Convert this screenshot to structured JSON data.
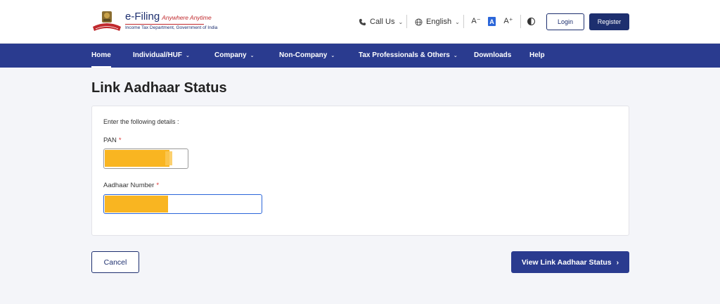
{
  "header": {
    "logo_title": "e-Filing",
    "logo_tagline": "Anywhere Anytime",
    "logo_subtitle": "Income Tax Department, Government of India",
    "call_us": "Call Us",
    "language": "English",
    "font_decrease": "A⁻",
    "font_default": "A",
    "font_increase": "A⁺",
    "login": "Login",
    "register": "Register"
  },
  "nav": {
    "items": [
      {
        "label": "Home",
        "caret": false
      },
      {
        "label": "Individual/HUF",
        "caret": true
      },
      {
        "label": "Company",
        "caret": true
      },
      {
        "label": "Non-Company",
        "caret": true
      },
      {
        "label": "Tax Professionals & Others",
        "caret": true
      },
      {
        "label": "Downloads",
        "caret": false
      },
      {
        "label": "Help",
        "caret": false
      }
    ]
  },
  "page": {
    "title": "Link Aadhaar Status"
  },
  "form": {
    "intro": "Enter the following details :",
    "pan_label": "PAN",
    "aadhaar_label": "Aadhaar Number",
    "required_mark": "*",
    "pan_value": "",
    "aadhaar_value": ""
  },
  "actions": {
    "cancel": "Cancel",
    "view_status": "View Link Aadhaar Status",
    "view_arrow": "›"
  },
  "colors": {
    "brand_navy": "#1d2f6f",
    "nav_blue": "#2a3b8f",
    "accent_red": "#c0292d",
    "focus_blue": "#2b66d9",
    "redaction": "#f9b521"
  }
}
